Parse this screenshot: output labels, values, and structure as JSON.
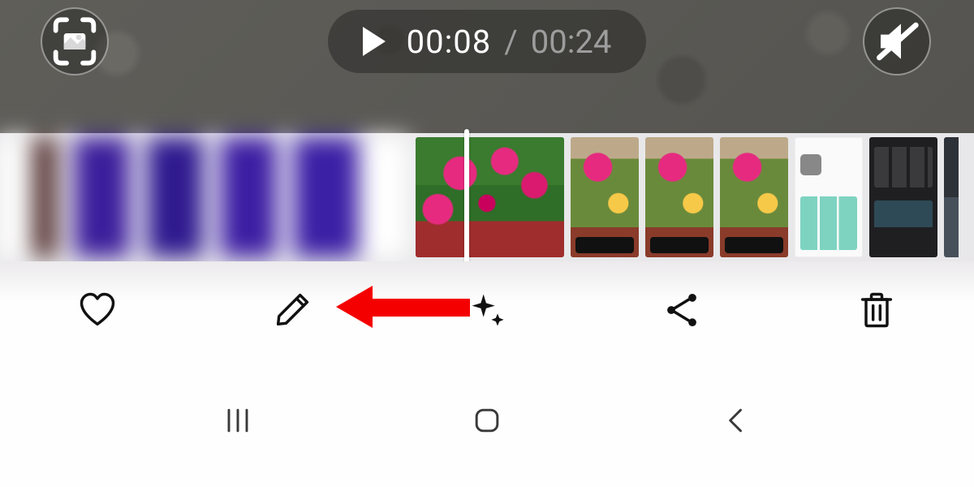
{
  "playback": {
    "current_time": "00:08",
    "separator": "/",
    "duration": "00:24",
    "muted": true,
    "playing": false
  },
  "top_controls": {
    "capture_icon": "capture-frame-icon",
    "mute_icon": "mute-icon"
  },
  "filmstrip": {
    "items": [
      {
        "kind": "current-video",
        "label": "current video (blurred)"
      },
      {
        "kind": "plants",
        "label": "pink flowers"
      },
      {
        "kind": "plant-ui",
        "label": "flowers screenshot 1"
      },
      {
        "kind": "plant-ui",
        "label": "flowers screenshot 2"
      },
      {
        "kind": "plant-ui",
        "label": "flowers screenshot 3"
      },
      {
        "kind": "settings",
        "label": "settings screenshot"
      },
      {
        "kind": "dark",
        "label": "dark app screenshot"
      },
      {
        "kind": "sliver",
        "label": "partial next item"
      }
    ]
  },
  "actions": {
    "favorite": "favorite",
    "edit": "edit",
    "effects": "effects",
    "share": "share",
    "delete": "delete"
  },
  "annotation": {
    "target": "edit",
    "direction": "left",
    "color": "#f40000"
  },
  "navigation": {
    "recents": "recents",
    "home": "home",
    "back": "back"
  }
}
